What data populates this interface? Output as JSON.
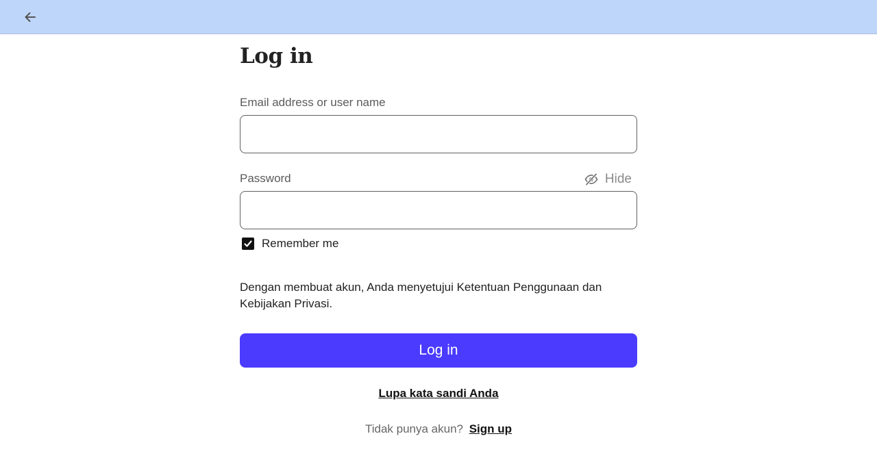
{
  "header": {
    "back_icon": "arrow-left-icon",
    "background": "#bfd6fb"
  },
  "login": {
    "title": "Log in",
    "email_label": "Email address or user name",
    "email_value": "",
    "password_label": "Password",
    "password_value": "",
    "hide_label": "Hide",
    "hide_icon": "eye-off-icon",
    "remember_label": "Remember me",
    "remember_checked": true,
    "terms_text": "Dengan membuat akun, Anda menyetujui Ketentuan Penggunaan dan Kebijakan Privasi.",
    "login_button": "Log in",
    "login_button_color": "#4a3bff",
    "forgot_link": "Lupa kata sandi Anda",
    "signup_prompt": "Tidak punya akun?",
    "signup_link": "Sign up"
  }
}
